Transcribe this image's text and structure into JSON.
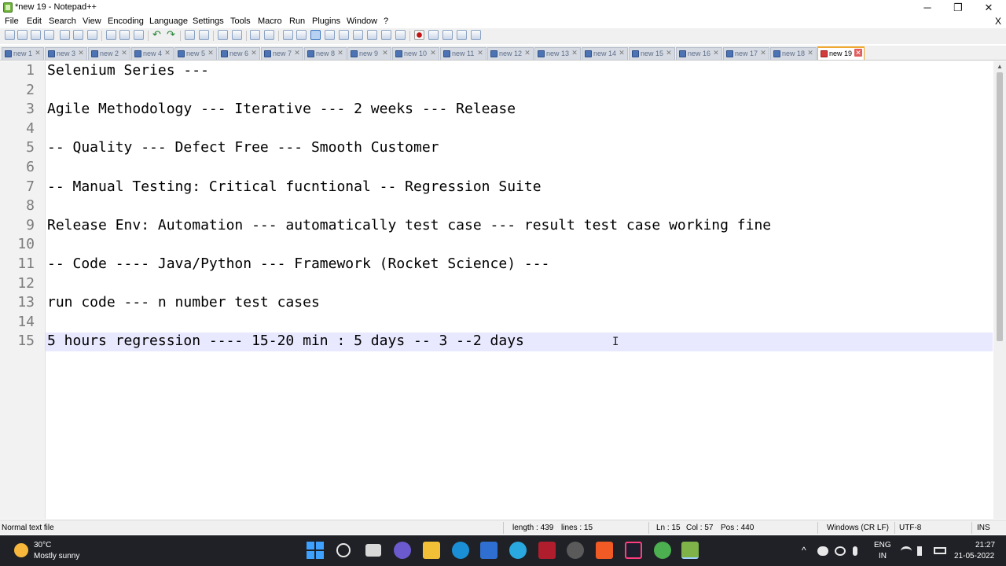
{
  "window": {
    "title": "*new 19 - Notepad++",
    "minimize_glyph": "─",
    "maximize_glyph": "❐",
    "close_glyph": "✕"
  },
  "menu": {
    "items": [
      "File",
      "Edit",
      "Search",
      "View",
      "Encoding",
      "Language",
      "Settings",
      "Tools",
      "Macro",
      "Run",
      "Plugins",
      "Window",
      "?"
    ],
    "close_glyph": "X"
  },
  "tabs": [
    {
      "label": "new 1"
    },
    {
      "label": "new 3"
    },
    {
      "label": "new 2"
    },
    {
      "label": "new 4"
    },
    {
      "label": "new 5"
    },
    {
      "label": "new 6"
    },
    {
      "label": "new 7"
    },
    {
      "label": "new 8"
    },
    {
      "label": "new 9"
    },
    {
      "label": "new 10"
    },
    {
      "label": "new 11"
    },
    {
      "label": "new 12"
    },
    {
      "label": "new 13"
    },
    {
      "label": "new 14"
    },
    {
      "label": "new 15"
    },
    {
      "label": "new 16"
    },
    {
      "label": "new 17"
    },
    {
      "label": "new 18"
    },
    {
      "label": "new 19",
      "active": true
    }
  ],
  "editor": {
    "line_numbers": [
      "1",
      "2",
      "3",
      "4",
      "5",
      "6",
      "7",
      "8",
      "9",
      "10",
      "11",
      "12",
      "13",
      "14",
      "15"
    ],
    "lines": [
      "Selenium Series ---",
      "",
      "Agile Methodology --- Iterative --- 2 weeks --- Release",
      "",
      "-- Quality --- Defect Free --- Smooth Customer",
      "",
      "-- Manual Testing: Critical fucntional -- Regression Suite",
      "",
      "Release Env: Automation --- automatically test case --- result test case working fine",
      "",
      "-- Code ---- Java/Python --- Framework (Rocket Science) ---",
      "",
      "run code --- n number test cases",
      "",
      "5 hours regression ---- 15-20 min : 5 days -- 3 --2 days"
    ],
    "current_line": 15,
    "caret_glyph": "I",
    "current_line_color": "#e8e8ff"
  },
  "status": {
    "file_type": "Normal text file",
    "length": "length : 439",
    "lines": "lines : 15",
    "ln": "Ln : 15",
    "col": "Col : 57",
    "pos": "Pos : 440",
    "eol": "Windows (CR LF)",
    "encoding": "UTF-8",
    "mode": "INS"
  },
  "taskbar": {
    "temperature": "30°C",
    "weather": "Mostly sunny",
    "language_top": "ENG",
    "language_bottom": "IN",
    "time": "21:27",
    "date": "21-05-2022",
    "chevron_glyph": "^"
  }
}
